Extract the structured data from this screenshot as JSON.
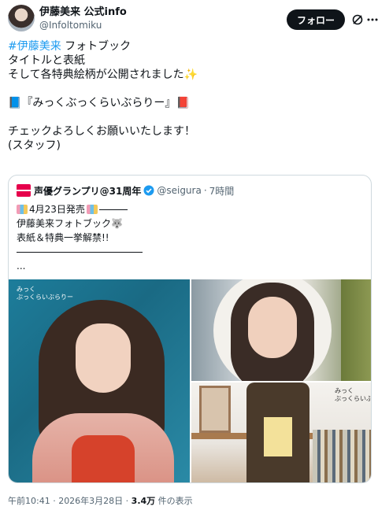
{
  "author": {
    "display_name": "伊藤美来 公式info",
    "handle": "@Infoltomiku",
    "follow_label": "フォロー"
  },
  "tweet": {
    "hashtag": "#伊藤美来",
    "line1_rest": " フォトブック",
    "line2": "タイトルと表紙",
    "line3": "そして各特典絵柄が公開されました",
    "line3_emoji": "✨",
    "line4_left_emoji": "📘",
    "line4_text": "『みっくぶっくらいぶらりー』",
    "line4_right_emoji": "📕",
    "line5": "チェックよろしくお願いいたします！",
    "line6": "(スタッフ)"
  },
  "quote": {
    "display_name": "声優グランプリ@31周年",
    "handle": "@seigura",
    "separator": "·",
    "time": "7時間",
    "line1": "4月23日発売",
    "line2": "伊藤美来フォトブック",
    "line2_emoji": "🐺",
    "line3": "表紙＆特典一挙解禁!!",
    "ellipsis": "..."
  },
  "media": {
    "main_title_1": "みっく",
    "main_title_2": "ぶっくらいぶらりー",
    "br_title_1": "みっく",
    "br_title_2": "ぶっくらいぶらりー"
  },
  "meta": {
    "time_date": "午前10:41 · 2026年3月28日 · ",
    "views_count": "3.4万",
    "views_label": " 件の表示"
  },
  "icons": {
    "grok": "grok-icon",
    "more": "more-icon",
    "verified": "verified-badge-icon"
  },
  "colors": {
    "link": "#1d9bf0",
    "text": "#0f1419",
    "muted": "#536471",
    "follow_bg": "#0f1419",
    "verified": "#1d9bf0"
  }
}
